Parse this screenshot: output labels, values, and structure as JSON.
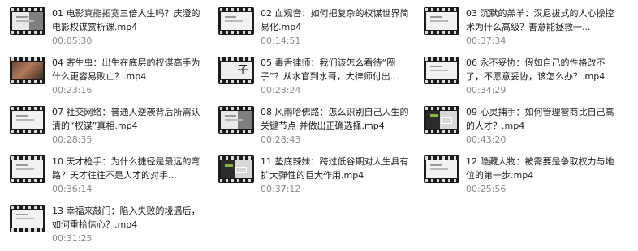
{
  "files": [
    {
      "title": "01 电影真能拓宽三倍人生吗？庆澄的电影权谋赏析课.mp4",
      "duration": "00:05:30",
      "thumb_icon": "video-thumbnail-icon"
    },
    {
      "title": "02 血观音：如何把复杂的权谋世界简易化.mp4",
      "duration": "00:14:51",
      "thumb_icon": "video-thumbnail-icon"
    },
    {
      "title": "03 沉默的羔羊：汉尼拔式的人心操控术为什么高级？善意能拯救一...",
      "duration": "00:37:34",
      "thumb_icon": "video-thumbnail-icon"
    },
    {
      "title": "04 寄生虫：出生在底层的权谋高手为什么更容易败亡？.mp4",
      "duration": "00:23:16",
      "thumb_icon": "video-thumbnail-icon"
    },
    {
      "title": "05 毒舌律师：我们该怎么看待“圈子”？从水官到水哥，大律师付出...",
      "duration": "00:28:24",
      "thumb_icon": "video-thumbnail-icon",
      "thumb_text": "子"
    },
    {
      "title": "06 永不妥协：假如自己的性格改不了，不愿意妥协，该怎么办？.mp4",
      "duration": "00:34:29",
      "thumb_icon": "video-thumbnail-icon"
    },
    {
      "title": "07 社交网络：普通人逆袭背后所需认清的“权谋”真相.mp4",
      "duration": "00:28:35",
      "thumb_icon": "video-thumbnail-icon"
    },
    {
      "title": "08 风雨哈佛路：怎么识别自己人生的关键节点 并做出正确选择.mp4",
      "duration": "00:28:43",
      "thumb_icon": "video-thumbnail-icon"
    },
    {
      "title": "09 心灵捕手：如何管理智商比自己高的人才？.mp4",
      "duration": "00:43:20",
      "thumb_icon": "video-thumbnail-icon"
    },
    {
      "title": "10 天才枪手：为什么捷径是最远的弯路？天才往往不是人才的对手...",
      "duration": "00:36:14",
      "thumb_icon": "video-thumbnail-icon"
    },
    {
      "title": "11 垫底辣妹：跨过低谷期对人生具有扩大弹性的巨大作用.mp4",
      "duration": "00:37:12",
      "thumb_icon": "video-thumbnail-icon"
    },
    {
      "title": "12 隐藏人物：被需要是争取权力与地位的第一步.mp4",
      "duration": "00:25:56",
      "thumb_icon": "video-thumbnail-icon"
    },
    {
      "title": "13 幸福来敲门：陷入失败的境遇后，如何重拾信心？.mp4",
      "duration": "00:31:25",
      "thumb_icon": "video-thumbnail-icon"
    }
  ],
  "colors": {
    "title_text": "#202020",
    "duration_text": "#8a8a8a",
    "background": "#ffffff"
  }
}
